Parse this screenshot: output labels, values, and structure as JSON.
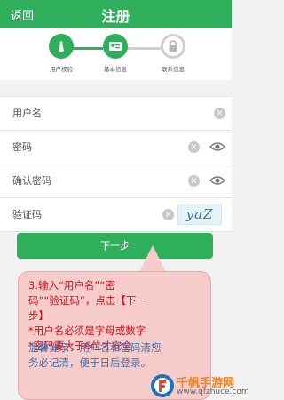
{
  "header": {
    "back_label": "返回",
    "title": "注册"
  },
  "steps": [
    {
      "label": "用户校验"
    },
    {
      "label": "基本信息"
    },
    {
      "label": "联系信息"
    }
  ],
  "form": {
    "username_placeholder": "用户名",
    "password_placeholder": "密码",
    "confirm_password_placeholder": "确认密码",
    "captcha_placeholder": "验证码",
    "captcha_text": "yaZ"
  },
  "next_button_label": "下一步",
  "annotation": {
    "instruction_lines": [
      "3.输入“用户名”“密",
      "码”“验证码”，点击【下一",
      "步】",
      "*用户名必须是字母或数字",
      "*密码要大于6位才安全"
    ],
    "hint_lines": [
      "温馨提示：用户名和密码清您",
      "务必记清，便于日后登录。"
    ]
  },
  "watermark": {
    "brand": "千帆手游网",
    "url": "www.qfzhuce.com"
  },
  "colors": {
    "brand_green": "#2fae5c",
    "note_red": "#d0141a",
    "hint_blue": "#3f6fb5"
  }
}
